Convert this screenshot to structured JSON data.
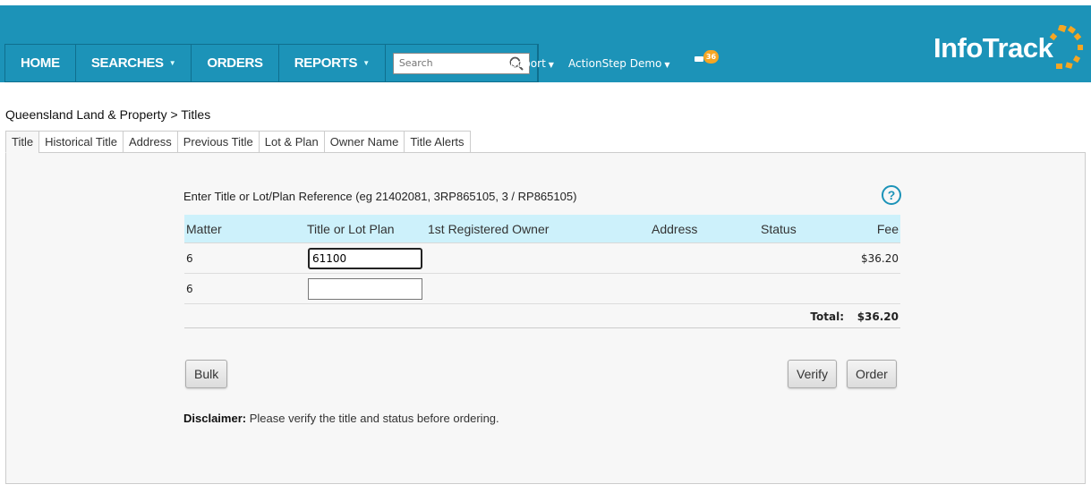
{
  "nav": {
    "home": "HOME",
    "searches": "SEARCHES",
    "orders": "ORDERS",
    "reports": "REPORTS",
    "search_placeholder": "Search",
    "isupport": "iSupport",
    "account": "ActionStep Demo",
    "notification_count": "36"
  },
  "logo": {
    "text": "InfoTrack"
  },
  "breadcrumb": "Queensland Land & Property > Titles",
  "tabs": [
    "Title",
    "Historical Title",
    "Address",
    "Previous Title",
    "Lot & Plan",
    "Owner Name",
    "Title Alerts"
  ],
  "form": {
    "instruction": "Enter Title or Lot/Plan Reference (eg 21402081, 3RP865105, 3 / RP865105)",
    "help": "?",
    "columns": {
      "matter": "Matter",
      "title": "Title or Lot Plan",
      "owner": "1st Registered Owner",
      "address": "Address",
      "status": "Status",
      "fee": "Fee"
    },
    "rows": [
      {
        "matter": "6",
        "title": "61100",
        "fee": "$36.20"
      },
      {
        "matter": "6",
        "title": "",
        "fee": ""
      }
    ],
    "total_label": "Total:",
    "total_value": "$36.20"
  },
  "buttons": {
    "bulk": "Bulk",
    "verify": "Verify",
    "order": "Order"
  },
  "disclaimer": {
    "label": "Disclaimer:",
    "text": " Please verify the title and status before ordering."
  },
  "colors": {
    "header": "#1c93b8",
    "table_header": "#cdf1fb",
    "logo_accent": "#f5a623"
  }
}
